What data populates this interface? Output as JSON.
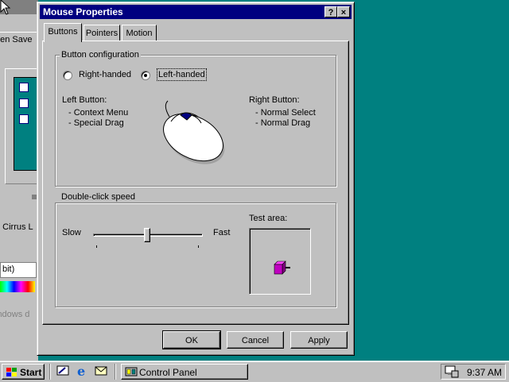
{
  "background_window": {
    "tab_fragment": "een Save",
    "adapter_fragment": "n Cirrus L",
    "colors_fragment": "bit)",
    "windows_fragment": "indows d"
  },
  "dialog": {
    "title": "Mouse Properties",
    "help_button": "?",
    "close_button": "×",
    "tabs": [
      {
        "label": "Buttons",
        "selected": true
      },
      {
        "label": "Pointers",
        "selected": false
      },
      {
        "label": "Motion",
        "selected": false
      }
    ],
    "button_config": {
      "label": "Button configuration",
      "options": [
        {
          "label": "Right-handed",
          "checked": false
        },
        {
          "label": "Left-handed",
          "checked": true
        }
      ],
      "left_button": {
        "title": "Left Button:",
        "items": [
          "- Context Menu",
          "- Special Drag"
        ]
      },
      "right_button": {
        "title": "Right Button:",
        "items": [
          "- Normal Select",
          "- Normal Drag"
        ]
      }
    },
    "double_click": {
      "label": "Double-click speed",
      "slow": "Slow",
      "fast": "Fast",
      "test_area": "Test area:",
      "slider_level": 0.5
    },
    "buttons": {
      "ok": "OK",
      "cancel": "Cancel",
      "apply": "Apply"
    }
  },
  "taskbar": {
    "start": "Start",
    "task_control_panel": "Control Panel",
    "clock": "9:37 AM"
  },
  "colors": {
    "desktop": "#008080",
    "title_bar": "#000080",
    "face": "#c0c0c0",
    "jack_in_the_box": "#c000c0"
  }
}
